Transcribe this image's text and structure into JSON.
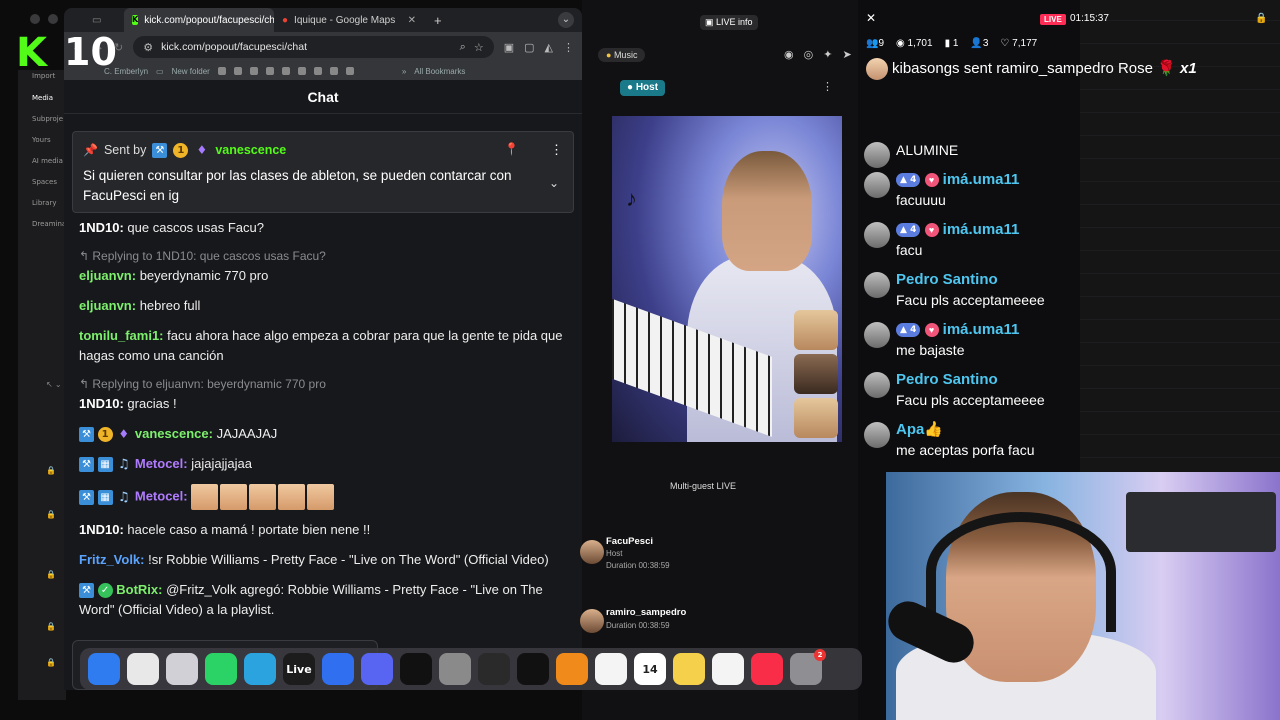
{
  "left_app": {
    "logo_letter": "K",
    "counter": "10",
    "sidebar_items": [
      "Import",
      "Media",
      "Subproje",
      "Yours",
      "AI media",
      "Spaces",
      "Library",
      "Dreamina"
    ]
  },
  "browser": {
    "tabs": [
      {
        "label": "kick.com/popout/facupesci/ch"
      },
      {
        "label": "Iquique - Google Maps"
      }
    ],
    "url": "kick.com/popout/facupesci/chat",
    "bookmarks": [
      "C. Emberlyn",
      "New folder"
    ],
    "all_bookmarks": "All Bookmarks",
    "chat_title": "Chat"
  },
  "pinned": {
    "sent_by": "Sent by",
    "user": "vanescence",
    "badge_sub": "1",
    "text": "Si quieren consultar por las clases de ableton, se pueden contarcar con FacuPesci en ig"
  },
  "colors": {
    "kick_green": "#53fc18",
    "user_green": "#7cf06c",
    "user_purple": "#b07cff",
    "user_blue": "#5aa3ff",
    "tiktok_name": "#4ec6f0"
  },
  "messages": [
    {
      "user": "1ND10:",
      "text": "que cascos usas Facu?",
      "color": "#ffffff"
    },
    {
      "reply": "Replying to 1ND10: que cascos usas Facu?",
      "user": "eljuanvn:",
      "text": "beyerdynamic 770 pro",
      "color": "#7cf06c"
    },
    {
      "user": "eljuanvn:",
      "text": "hebreo full",
      "color": "#7cf06c"
    },
    {
      "user": "tomilu_fami1:",
      "text": "facu ahora hace algo empeza a cobrar para que la gente te pida que hagas como una canción",
      "color": "#7cf06c"
    },
    {
      "reply": "Replying to eljuanvn: beyerdynamic 770 pro",
      "user": "1ND10:",
      "text": "gracias !",
      "color": "#ffffff"
    },
    {
      "user": "vanescence:",
      "text": "JAJAAJAJ",
      "color": "#7cf06c",
      "badges": "sub"
    },
    {
      "user": "Metocel:",
      "text": "jajajajjajaa",
      "color": "#b07cff",
      "badges": "music"
    },
    {
      "user": "Metocel:",
      "text": "",
      "color": "#b07cff",
      "badges": "music",
      "emotes": 5
    },
    {
      "user": "1ND10:",
      "text": "hacele caso a mamá ! portate bien nene !!",
      "color": "#ffffff"
    },
    {
      "user": "Fritz_Volk:",
      "text": "!sr Robbie Williams - Pretty Face - \"Live on The Word\" (Official Video)",
      "color": "#5aa3ff"
    },
    {
      "user": "BotRix:",
      "text": "@Fritz_Volk agregó: Robbie Williams - Pretty Face - \"Live on The Word\" (Official Video) a la playlist.",
      "color": "#7cf06c",
      "badges": "bot"
    }
  ],
  "live": {
    "live_info": "LIVE info",
    "music": "Music",
    "host": "Host",
    "multi_guest": "Multi-guest LIVE",
    "guests": [
      {
        "name": "FacuPesci",
        "role": "Host",
        "duration": "Duration 00:38:59"
      },
      {
        "name": "ramiro_sampedro",
        "role": "",
        "duration": "Duration 00:38:59"
      }
    ]
  },
  "dock": {
    "icons": [
      {
        "name": "finder-icon",
        "label": "",
        "bg": "#2f7bf0"
      },
      {
        "name": "chrome-icon",
        "label": "",
        "bg": "#e8e8e8"
      },
      {
        "name": "launchpad-icon",
        "label": "",
        "bg": "#d0d0d6"
      },
      {
        "name": "whatsapp-icon",
        "label": "",
        "bg": "#2bd366"
      },
      {
        "name": "telegram-icon",
        "label": "",
        "bg": "#2aa3df"
      },
      {
        "name": "live-icon",
        "label": "Live",
        "bg": "#1c1c1c"
      },
      {
        "name": "shazam-icon",
        "label": "",
        "bg": "#2f6ff0"
      },
      {
        "name": "discord-icon",
        "label": "",
        "bg": "#5865f2"
      },
      {
        "name": "capcut-icon",
        "label": "",
        "bg": "#111111"
      },
      {
        "name": "scanner-icon",
        "label": "",
        "bg": "#8a8a8a"
      },
      {
        "name": "obs-icon",
        "label": "",
        "bg": "#2a2a2a"
      },
      {
        "name": "tiktok-icon",
        "label": "",
        "bg": "#111111"
      },
      {
        "name": "vlc-icon",
        "label": "",
        "bg": "#f08a1a"
      },
      {
        "name": "photos-icon",
        "label": "",
        "bg": "#f4f4f4"
      },
      {
        "name": "calendar-icon",
        "label": "14",
        "bg": "#ffffff"
      },
      {
        "name": "notes-icon",
        "label": "",
        "bg": "#f5d04a"
      },
      {
        "name": "freeform-icon",
        "label": "",
        "bg": "#f4f4f4"
      },
      {
        "name": "music-icon",
        "label": "",
        "bg": "#fa2d48"
      },
      {
        "name": "settings-icon",
        "label": "",
        "bg": "#8e8e93",
        "badge": "2"
      }
    ]
  },
  "tiktok": {
    "live_badge": "LIVE",
    "timer": "01:15:37",
    "stats": [
      "9",
      "1,701",
      "1",
      "3",
      "7,177"
    ],
    "gift": {
      "user": "kibasongs",
      "text": "sent ramiro_sampedro Rose",
      "count": "x1"
    },
    "chat": [
      {
        "name": "",
        "text": "ALUMINE"
      },
      {
        "name": "imá.uma11",
        "level": "4",
        "text": "facuuuu"
      },
      {
        "name": "imá.uma11",
        "level": "4",
        "text": "facu"
      },
      {
        "name": "Pedro Santino",
        "text": "Facu pls acceptameeee"
      },
      {
        "name": "imá.uma11",
        "level": "4",
        "text": "me bajaste"
      },
      {
        "name": "Pedro Santino",
        "text": "Facu pls acceptameeee"
      },
      {
        "name": "Apa👍",
        "text": "me aceptas porfa facu"
      }
    ]
  }
}
